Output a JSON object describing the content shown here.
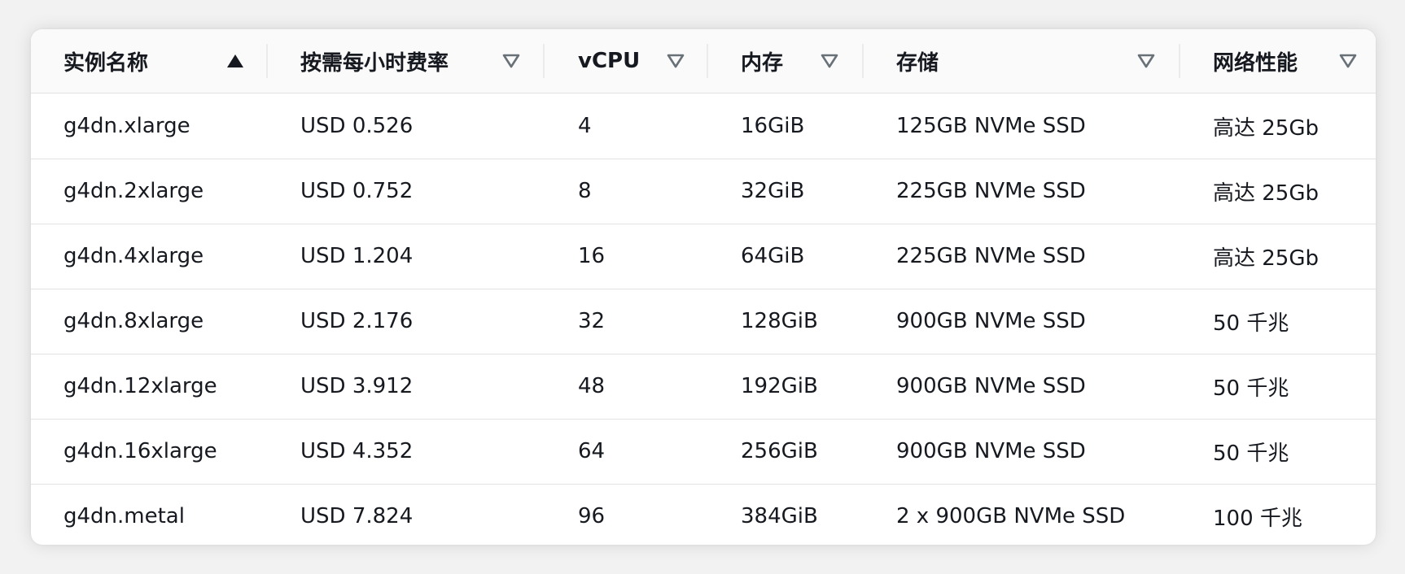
{
  "columns": [
    {
      "label": "实例名称",
      "sort": "ascending"
    },
    {
      "label": "按需每小时费率",
      "sort": "none"
    },
    {
      "label": "vCPU",
      "sort": "none"
    },
    {
      "label": "内存",
      "sort": "none"
    },
    {
      "label": "存储",
      "sort": "none"
    },
    {
      "label": "网络性能",
      "sort": "none"
    }
  ],
  "rows": [
    [
      "g4dn.xlarge",
      "USD 0.526",
      "4",
      "16GiB",
      "125GB NVMe SSD",
      "高达 25Gb"
    ],
    [
      "g4dn.2xlarge",
      "USD 0.752",
      "8",
      "32GiB",
      "225GB NVMe SSD",
      "高达 25Gb"
    ],
    [
      "g4dn.4xlarge",
      "USD 1.204",
      "16",
      "64GiB",
      "225GB NVMe SSD",
      "高达 25Gb"
    ],
    [
      "g4dn.8xlarge",
      "USD 2.176",
      "32",
      "128GiB",
      "900GB NVMe SSD",
      "50 千兆"
    ],
    [
      "g4dn.12xlarge",
      "USD 3.912",
      "48",
      "192GiB",
      "900GB NVMe SSD",
      "50 千兆"
    ],
    [
      "g4dn.16xlarge",
      "USD 4.352",
      "64",
      "256GiB",
      "900GB NVMe SSD",
      "50 千兆"
    ],
    [
      "g4dn.metal",
      "USD 7.824",
      "96",
      "384GiB",
      "2 x 900GB NVMe SSD",
      "100 千兆"
    ]
  ],
  "icons": {
    "ascending": "sort-ascending-icon",
    "none": "sort-neutral-icon"
  },
  "colors": {
    "text": "#16191f",
    "header_bg": "#fafafa",
    "border": "#e2e2e2",
    "sort_icon": "#687078"
  }
}
